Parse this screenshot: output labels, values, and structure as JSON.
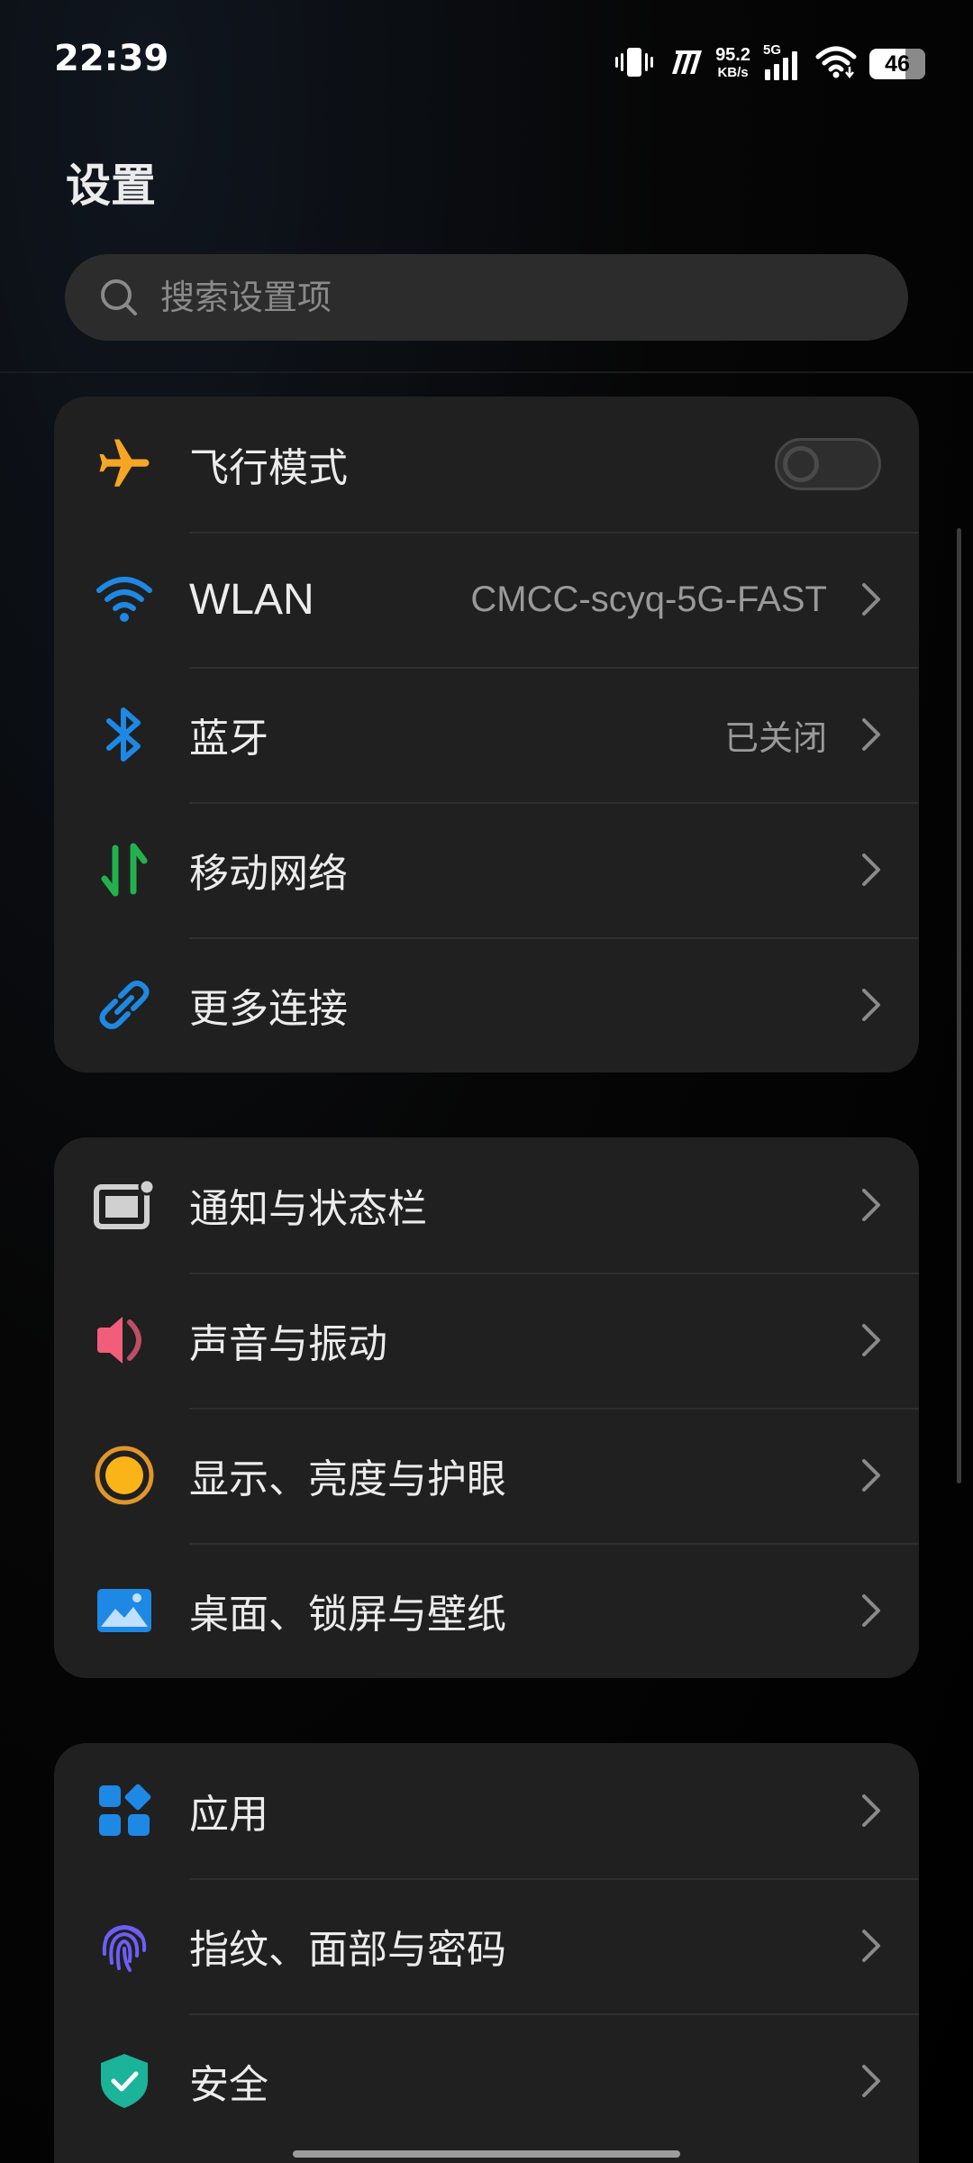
{
  "status_bar": {
    "time": "22:39",
    "speed_value": "95.2",
    "speed_unit": "KB/s",
    "network_type": "5G",
    "battery": "46",
    "icons": [
      "vibrate-icon",
      "hd-icon",
      "signal-icon",
      "wifi-icon",
      "battery-icon"
    ]
  },
  "header": {
    "title": "设置",
    "search_placeholder": "搜索设置项"
  },
  "colors": {
    "airplane": "#f5a623",
    "wlan": "#1e88e5",
    "bluetooth": "#1e88e5",
    "mobile_network": "#23b14d",
    "more_connections": "#1e88e5",
    "notification": "#d0d0d0",
    "sound": "#f25d7c",
    "display": "#f5a623",
    "wallpaper": "#1e88e5",
    "apps": "#1e88e5",
    "fingerprint": "#6e5ef5",
    "security": "#1bb399"
  },
  "groups": [
    {
      "items": [
        {
          "label": "飞行模式",
          "icon": "airplane-icon",
          "toggle": false
        },
        {
          "label": "WLAN",
          "value": "CMCC-scyq-5G-FAST",
          "icon": "wifi-icon"
        },
        {
          "label": "蓝牙",
          "value": "已关闭",
          "icon": "bluetooth-icon"
        },
        {
          "label": "移动网络",
          "icon": "mobile-data-icon"
        },
        {
          "label": "更多连接",
          "icon": "link-icon"
        }
      ]
    },
    {
      "items": [
        {
          "label": "通知与状态栏",
          "icon": "notification-icon"
        },
        {
          "label": "声音与振动",
          "icon": "speaker-icon"
        },
        {
          "label": "显示、亮度与护眼",
          "icon": "brightness-icon"
        },
        {
          "label": "桌面、锁屏与壁纸",
          "icon": "wallpaper-icon"
        }
      ]
    },
    {
      "items": [
        {
          "label": "应用",
          "icon": "apps-icon"
        },
        {
          "label": "指纹、面部与密码",
          "icon": "fingerprint-icon"
        },
        {
          "label": "安全",
          "icon": "shield-icon"
        }
      ]
    }
  ]
}
